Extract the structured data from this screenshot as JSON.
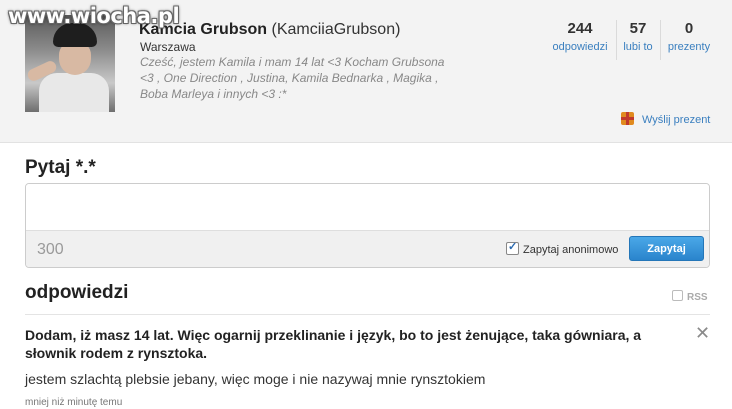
{
  "watermark": "www.wiocha.pl",
  "profile": {
    "fullname": "Kamcia Grubson",
    "username": "(KamciiaGrubson)",
    "location": "Warszawa",
    "bio": "Cześć, jestem Kamila i mam 14 lat <3 Kocham Grubsona <3 , One Direction , Justina, Kamila Bednarka , Magika , Boba Marleya i innych <3 :*"
  },
  "stats": [
    {
      "value": "244",
      "label": "odpowiedzi"
    },
    {
      "value": "57",
      "label": "lubi to"
    },
    {
      "value": "0",
      "label": "prezenty"
    }
  ],
  "gift": {
    "label": "Wyślij prezent",
    "icon": "gift-icon"
  },
  "ask": {
    "title": "Pytaj *.*",
    "textarea_value": "",
    "char_count": "300",
    "anonymous_label": "Zapytaj anonimowo",
    "anonymous_checked": true,
    "submit_label": "Zapytaj"
  },
  "answers": {
    "title": "odpowiedzi",
    "rss_label": "RSS",
    "items": [
      {
        "question": "Dodam, iż masz 14 lat. Więc ogarnij przeklinanie i język, bo to jest żenujące, taka gówniara, a słownik rodem z rynsztoka.",
        "answer": "jestem szlachtą plebsie jebany, więc moge i nie nazywaj mnie rynsztokiem",
        "time": "mniej niż minutę temu"
      }
    ]
  },
  "colors": {
    "accent": "#3a7fbf",
    "button": "#2a84cc",
    "header_bg": "#f3f3f3"
  }
}
